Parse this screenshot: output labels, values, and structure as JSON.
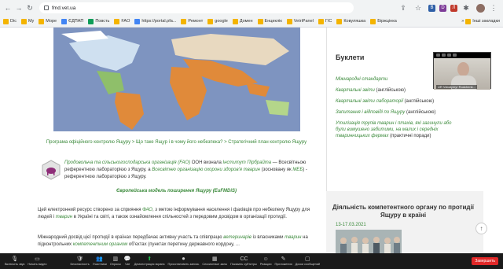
{
  "browser": {
    "url": "fmd.vet.ua",
    "nav": {
      "back": "←",
      "forward": "→",
      "reload": "↻"
    },
    "extensions": [
      "B",
      "D",
      "Л"
    ],
    "extension_colors": [
      "#2e5fa7",
      "#7d3c98",
      "#c0392b"
    ],
    "icons": [
      "lock-icon",
      "share-icon",
      "star-icon",
      "puzzle-icon",
      "menu-dots-icon"
    ]
  },
  "bookmarks": {
    "items": [
      "Dic",
      "My",
      "Море",
      "ЄДПАП",
      "Повсть",
      "FAO",
      "https://portal.pfa...",
      "Ремонт",
      "google",
      "Домен",
      "Енциклік",
      "VetriPanel",
      "ГІС",
      "Ковуляшка",
      "Біржцінка"
    ],
    "more": "»",
    "other": "Інші закладки"
  },
  "page": {
    "breadcrumb": "Програма офіційного контролю Ящуру > Що таке Ящур і в чому його небезпека? > Стратегічний план контролю Ящуру",
    "info": {
      "link1": "Продовольча та сільськогосподарська організація (FAO)",
      "text1": " ООН визнала ",
      "link2": "Інститут Пірбрайта",
      "text2": " — Всесвітньою референтною лабораторією з Ящуру, а ",
      "link3": "Всесвітню організацію охорони здоров'я тварин",
      "text3": " (зосновану як ",
      "link4": "МЕБ",
      "text4": ") - референтною лабораторією з Ящуру."
    },
    "model_link": "Європейська модель поширення Ящуру (EuFMDiS)",
    "paragraph1": {
      "t1": "Цей електронний ресурс створено за сприяння ",
      "l1": "ФАО",
      "t2": ", з метою інформування населення і фахівців про небезпеку Ящуру для людей і ",
      "l2": "тварин",
      "t3": " в Україні та світі, а також ознайомлення спільностей з передовим досвідом в організації протидії."
    },
    "paragraph2": {
      "t1": "Міжнародний досвід цієї протидії в країнах передбачає активну участь та співпрацю ",
      "l1": "ветеринарів",
      "t2": " із власниками ",
      "l2": "тварин",
      "t3": " на підконтрольних ",
      "l3": "компетентним органом",
      "t4": " об'єктах (пунктах перетину державного кордону, ..."
    }
  },
  "sidebar": {
    "booklets_title": "Буклети",
    "booklets": [
      {
        "link": "Міжнародні стандарти",
        "suffix": ""
      },
      {
        "link": "Квартальні звіти",
        "suffix": " (англійською)"
      },
      {
        "link": "Квартальні звіти лабораторії",
        "suffix": " (англійською)"
      },
      {
        "link": "Запитання і відповіді по Ящуру",
        "suffix": " (англійською)"
      },
      {
        "link": "Утилізація трупів тварин і птахів, які загинули або були вимушено забитими, на малих і середніх тваринницьких фермах",
        "suffix": " (практичні поради)"
      }
    ],
    "activity_title": "Діяльність компетентного органу по протидії Ящуру в країні",
    "activity_date": "13-17.03.2021"
  },
  "video": {
    "name": "UR Volodymyr Rodchenk..."
  },
  "scroll_top": "↑",
  "zoom_toolbar": {
    "items": [
      {
        "icon": "🎙",
        "label": "Включить звук",
        "icon_name": "microphone-icon"
      },
      {
        "icon": "▭",
        "label": "Начать видео",
        "icon_name": "video-icon"
      },
      {
        "icon": "🛡",
        "label": "Безопасность",
        "icon_name": "shield-icon"
      },
      {
        "icon": "👥",
        "label": "Участники",
        "icon_name": "participants-icon"
      },
      {
        "icon": "▥",
        "label": "Опросы",
        "icon_name": "polls-icon"
      },
      {
        "icon": "💬",
        "label": "Чат",
        "icon_name": "chat-icon"
      },
      {
        "icon": "⬆",
        "label": "Демонстрация экрана",
        "icon_name": "share-screen-icon",
        "active": true
      },
      {
        "icon": "⏺",
        "label": "Приостановить запись",
        "icon_name": "record-icon"
      },
      {
        "icon": "▦",
        "label": "Сессионные залы",
        "icon_name": "breakout-icon"
      },
      {
        "icon": "CC",
        "label": "Показать субтитры",
        "icon_name": "captions-icon"
      },
      {
        "icon": "☺",
        "label": "Реакции",
        "icon_name": "reactions-icon"
      },
      {
        "icon": "✎",
        "label": "Приложения",
        "icon_name": "apps-icon"
      },
      {
        "icon": "▢",
        "label": "Доски сообщений",
        "icon_name": "whiteboard-icon"
      }
    ],
    "end_label": "Завершить"
  }
}
